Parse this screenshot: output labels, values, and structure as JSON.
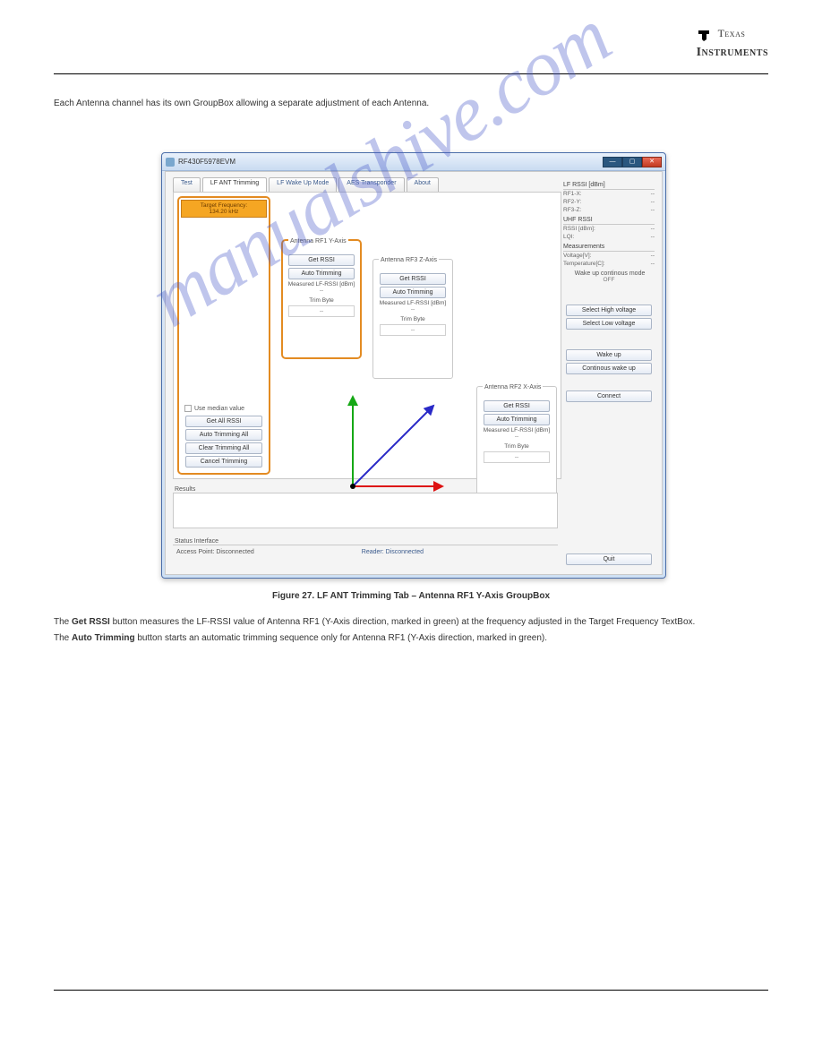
{
  "brand": {
    "name1": "Texas",
    "name2": "Instruments"
  },
  "pre_caption": "Each Antenna channel has its own GroupBox allowing a separate adjustment of each Antenna.",
  "watermark": "manualshive.com",
  "caption": "Figure 27. LF ANT Trimming Tab – Antenna RF1 Y-Axis GroupBox",
  "post_paragraphs": [
    {
      "label": "Get RSSI",
      "text": "button measures the LF-RSSI value of Antenna RF1 (Y-Axis direction, marked in green) at the frequency adjusted in the Target Frequency TextBox."
    },
    {
      "label": "Auto Trimming",
      "text": "button starts an automatic trimming sequence only for Antenna RF1 (Y-Axis direction, marked in green)."
    }
  ],
  "window": {
    "title": "RF430F5978EVM",
    "tabs": [
      "Test",
      "LF ANT Trimming",
      "LF Wake Up Mode",
      "AES Transponder",
      "About"
    ],
    "target_freq_label": "Target Frequency:",
    "target_freq_value": "134.20 kHz",
    "use_median": "Use median value",
    "left_buttons": [
      "Get All RSSI",
      "Auto Trimming All",
      "Clear Trimming All",
      "Cancel Trimming"
    ],
    "antennas": {
      "rf1": {
        "title": "Antenna RF1 Y-Axis",
        "get": "Get RSSI",
        "auto": "Auto Trimming",
        "meas": "Measured LF-RSSI [dBm]",
        "meas_v": "--",
        "trim": "Trim Byte",
        "trim_v": "--"
      },
      "rf3": {
        "title": "Antenna RF3 Z-Axis",
        "get": "Get RSSI",
        "auto": "Auto Trimming",
        "meas": "Measured LF-RSSI [dBm]",
        "meas_v": "--",
        "trim": "Trim Byte",
        "trim_v": "--"
      },
      "rf2": {
        "title": "Antenna RF2 X-Axis",
        "get": "Get RSSI",
        "auto": "Auto Trimming",
        "meas": "Measured LF-RSSI [dBm]",
        "meas_v": "--",
        "trim": "Trim Byte",
        "trim_v": "--"
      }
    },
    "results_label": "Results",
    "status_label": "Status Interface",
    "status_ap": "Access Point: Disconnected",
    "status_rd": "Reader: Disconnected"
  },
  "right": {
    "lfrssi_h": "LF RSSI [dBm]",
    "lfrssi": [
      [
        "RF1-X:",
        "--"
      ],
      [
        "RF2-Y:",
        "--"
      ],
      [
        "RF3-Z:",
        "--"
      ]
    ],
    "uhf_h": "UHF RSSI",
    "uhf": [
      [
        "RSSI [dBm]:",
        "--"
      ],
      [
        "LQI:",
        "--"
      ]
    ],
    "meas_h": "Measurements",
    "meas": [
      [
        "Voltage[V]:",
        "--"
      ],
      [
        "Temperature[C]:",
        "--"
      ]
    ],
    "wake_h": "Wake up continous mode",
    "wake_v": "OFF",
    "buttons1": [
      "Select High voltage",
      "Select Low voltage"
    ],
    "buttons2": [
      "Wake up",
      "Continous wake up"
    ],
    "connect": "Connect",
    "quit": "Quit"
  }
}
